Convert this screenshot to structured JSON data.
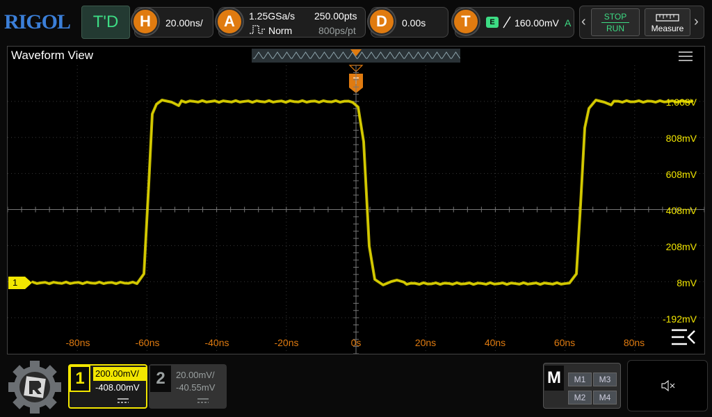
{
  "brand": "RIGOL",
  "trigger_state": "T'D",
  "horizontal": {
    "badge": "H",
    "timebase": "20.00ns/"
  },
  "acquire": {
    "badge": "A",
    "sample_rate": "1.25GSa/s",
    "memory_depth": "250.00pts",
    "mode": "Norm",
    "sample_interval": "800ps/pt"
  },
  "delay": {
    "badge": "D",
    "value": "0.00s"
  },
  "trigger": {
    "badge": "T",
    "source_tag": "E",
    "level": "160.00mV",
    "sweep": "A"
  },
  "run_control": {
    "stop_label": "STOP",
    "run_label": "RUN"
  },
  "measure_label": "Measure",
  "waveform_view": {
    "title": "Waveform View",
    "trigger_marker": "T",
    "channel_marker": "1",
    "y_labels": [
      "1.008V",
      "808mV",
      "608mV",
      "408mV",
      "208mV",
      "8mV",
      "-192mV"
    ],
    "x_labels": [
      "-80ns",
      "-60ns",
      "-40ns",
      "-20ns",
      "0s",
      "20ns",
      "40ns",
      "60ns",
      "80ns"
    ]
  },
  "channel1": {
    "number": "1",
    "scale": "200.00mV/",
    "offset": "-408.00mV"
  },
  "channel2": {
    "number": "2",
    "scale": "20.00mV/",
    "offset": "-40.55mV"
  },
  "math": {
    "label": "M",
    "items": [
      "M1",
      "M3",
      "M2",
      "M4"
    ]
  },
  "colors": {
    "ch1": "#f2e600",
    "accent": "#e07b10",
    "green": "#3ddc84",
    "grid": "#3a3a3a"
  }
}
